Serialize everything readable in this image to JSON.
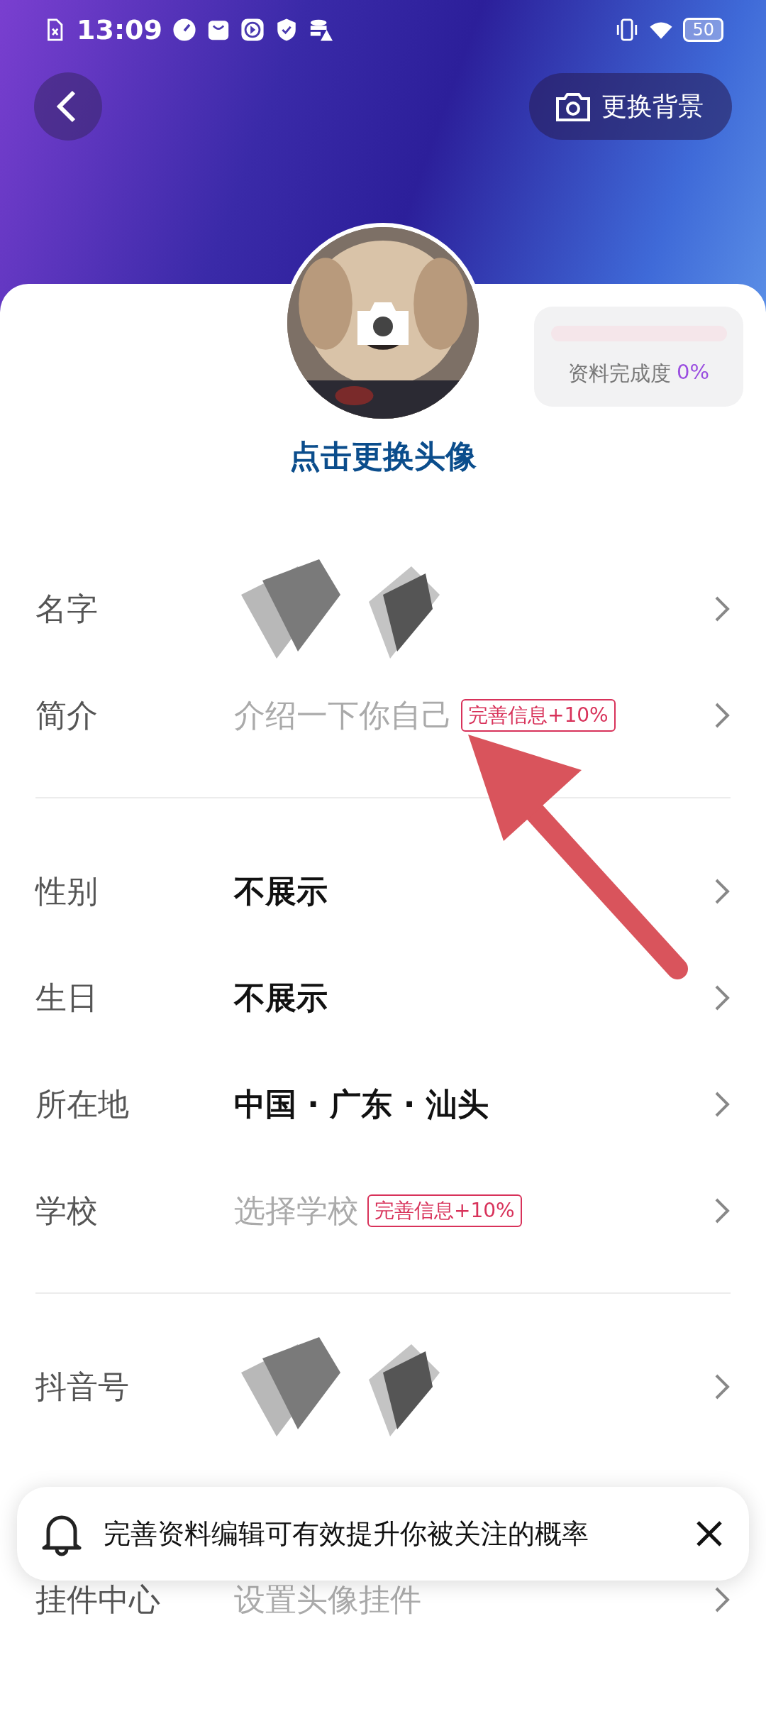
{
  "status_bar": {
    "time": "13:09",
    "battery": "50"
  },
  "header": {
    "change_background": "更换背景"
  },
  "profile": {
    "change_avatar": "点击更换头像",
    "completion": {
      "label": "资料完成度",
      "value": "0%",
      "level": 0
    }
  },
  "sections": [
    [
      {
        "label": "名字",
        "kind": "redacted"
      },
      {
        "label": "简介",
        "kind": "placeholder",
        "value": "介绍一下你自己",
        "badge": "完善信息+10%"
      }
    ],
    [
      {
        "label": "性别",
        "kind": "value",
        "value": "不展示"
      },
      {
        "label": "生日",
        "kind": "value",
        "value": "不展示"
      },
      {
        "label": "所在地",
        "kind": "value",
        "value": "中国 · 广东 · 汕头"
      },
      {
        "label": "学校",
        "kind": "placeholder",
        "value": "选择学校",
        "badge": "完善信息+10%"
      }
    ],
    [
      {
        "label": "抖音号",
        "kind": "redacted"
      },
      {
        "label": "挂件中心",
        "kind": "placeholder",
        "value": "设置头像挂件"
      }
    ]
  ],
  "toast": {
    "message": "完善资料编辑可有效提升你被关注的概率"
  }
}
